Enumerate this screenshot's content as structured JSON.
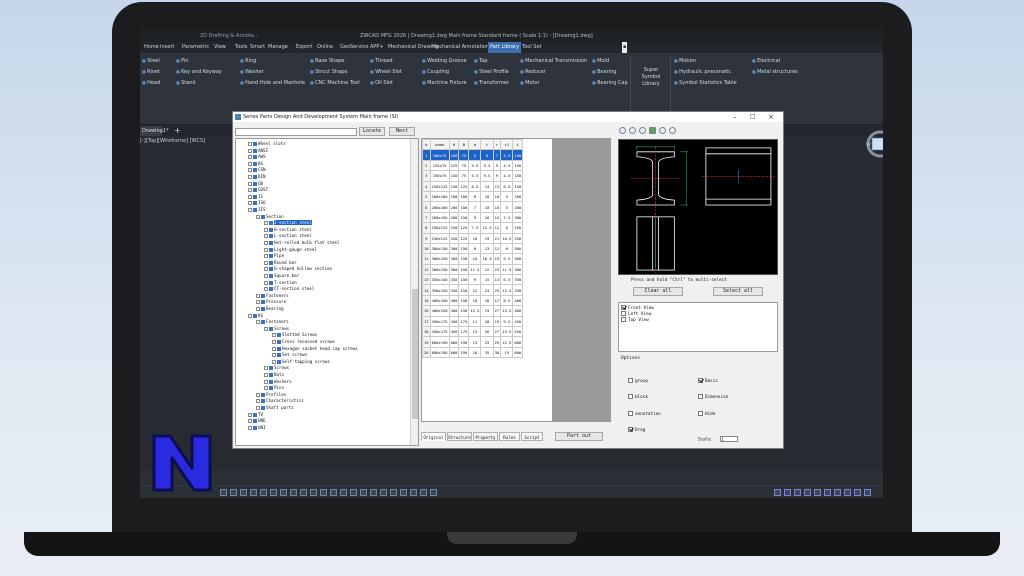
{
  "app": {
    "title": "ZWCAD MFG 2026 | Drawing1.dwg Main frame   Standard frame ( Scale 1:1)  - [Drawing1.dwg]",
    "quick_access": "2D Drafting & Annota..."
  },
  "menu": [
    "Home",
    "Insert",
    "Parametric",
    "View",
    "Tools",
    "Smart",
    "Manage",
    "Export",
    "Online",
    "GeoService",
    "APP+",
    "Mechanical Drawing",
    "Mechanical Annotation",
    "Part Library",
    "Tool Set"
  ],
  "menu_active": "Part Library",
  "ribbon": {
    "col1": [
      "Steel",
      "Rivet",
      "Head"
    ],
    "col2": [
      "Pin",
      "Key and Keyway",
      "Stand"
    ],
    "col3": [
      "Ring",
      "Washer",
      "Hand Hole and Manhole"
    ],
    "col4": [
      "Base Shape",
      "Struct Shape",
      "CNC Machine Tool"
    ],
    "col5": [
      "Thread",
      "Wheel Slot",
      "Oil Slot"
    ],
    "col6": [
      "Welding Groove",
      "Coupling",
      "Machine Fixture"
    ],
    "col7": [
      "Tap",
      "Steel Profile",
      "Transformer"
    ],
    "col8": [
      "Mechanical Transmission",
      "Reducer",
      "Motor"
    ],
    "col9": [
      "Mold",
      "Bearing",
      "Bearing Cap"
    ],
    "super_symbol": "Super Symbol Library",
    "col10": [
      "Motion",
      "Hydraulic pneumatic",
      "Symbol Statistics Table"
    ],
    "col11": [
      "Electrical",
      "Metal structures"
    ],
    "group_part": "Part Library",
    "group_symbol": "Super Symbol Library"
  },
  "doc_tab": "Drawing1*",
  "viewport_label": "[-][Top][Wireframe] [WCS]",
  "dialog": {
    "title": "Series Parts Design And Development System Main frame (SI)",
    "locate_label": "Locate",
    "next_label": "Next",
    "tree": [
      {
        "label": "Wheel slots",
        "level": 0
      },
      {
        "label": "ANSI",
        "level": 0
      },
      {
        "label": "AWS",
        "level": 0
      },
      {
        "label": "BS",
        "level": 0
      },
      {
        "label": "CSN",
        "level": 0
      },
      {
        "label": "DIN",
        "level": 0
      },
      {
        "label": "GB",
        "level": 0
      },
      {
        "label": "GOST",
        "level": 0
      },
      {
        "label": "IS",
        "level": 0
      },
      {
        "label": "ISO",
        "level": 0
      },
      {
        "label": "JIS",
        "level": 0
      },
      {
        "label": "Section",
        "level": 1
      },
      {
        "label": "I-section steel",
        "level": 2,
        "selected": true
      },
      {
        "label": "H-section steel",
        "level": 2
      },
      {
        "label": "L-section steel",
        "level": 2
      },
      {
        "label": "Hot-rolled bulb flat steel",
        "level": 2
      },
      {
        "label": "Light-gauge steel",
        "level": 2
      },
      {
        "label": "Pipe",
        "level": 2
      },
      {
        "label": "Round bar",
        "level": 2
      },
      {
        "label": "U-shaped hollow section",
        "level": 2
      },
      {
        "label": "Square bar",
        "level": 2
      },
      {
        "label": "T-section",
        "level": 2
      },
      {
        "label": "CT-section steel",
        "level": 2
      },
      {
        "label": "Fasteners",
        "level": 1
      },
      {
        "label": "Pressure",
        "level": 1
      },
      {
        "label": "Bearing",
        "level": 1
      },
      {
        "label": "KS",
        "level": 0
      },
      {
        "label": "Fasteners",
        "level": 1
      },
      {
        "label": "Screws",
        "level": 2
      },
      {
        "label": "Slotted Screws",
        "level": 3
      },
      {
        "label": "Cross recessed screws",
        "level": 3
      },
      {
        "label": "Hexagon socket head cap screws",
        "level": 3
      },
      {
        "label": "Set screws",
        "level": 3
      },
      {
        "label": "Self-tapping screws",
        "level": 3
      },
      {
        "label": "Screws",
        "level": 2
      },
      {
        "label": "Nuts",
        "level": 2
      },
      {
        "label": "Washers",
        "level": 2
      },
      {
        "label": "Pins",
        "level": 2
      },
      {
        "label": "Profiles",
        "level": 1
      },
      {
        "label": "Characteristics",
        "level": 1
      },
      {
        "label": "Shaft parts",
        "level": 1
      },
      {
        "label": "TV",
        "level": 0
      },
      {
        "label": "UNE",
        "level": 0
      },
      {
        "label": "UNI",
        "level": 0
      }
    ],
    "table": {
      "columns": [
        "b",
        "name",
        "H",
        "B",
        "d",
        "t",
        "r",
        "r1",
        "L"
      ],
      "rows": [
        [
          "1",
          "100x75",
          "100",
          "75",
          "5",
          "8",
          "7",
          "3.5",
          "150"
        ],
        [
          "2",
          "125x75",
          "125",
          "75",
          "5.5",
          "9.5",
          "9",
          "4.5",
          "150"
        ],
        [
          "3",
          "150x75",
          "150",
          "75",
          "5.5",
          "9.5",
          "9",
          "4.5",
          "150"
        ],
        [
          "4",
          "150x125",
          "150",
          "125",
          "8.5",
          "14",
          "13",
          "6.5",
          "150"
        ],
        [
          "5",
          "180x100",
          "180",
          "100",
          "6",
          "10",
          "10",
          "5",
          "200"
        ],
        [
          "6",
          "200x100",
          "200",
          "100",
          "7",
          "10",
          "10",
          "5",
          "200"
        ],
        [
          "7",
          "200x150",
          "200",
          "150",
          "9",
          "16",
          "15",
          "7.5",
          "300"
        ],
        [
          "8",
          "250x125",
          "250",
          "125",
          "7.5",
          "12.5",
          "12",
          "6",
          "250"
        ],
        [
          "9",
          "250x125",
          "250",
          "125",
          "10",
          "19",
          "21",
          "10.5",
          "250"
        ],
        [
          "10",
          "300x150",
          "300",
          "150",
          "8",
          "13",
          "12",
          "6",
          "300"
        ],
        [
          "11",
          "300x150",
          "300",
          "150",
          "10",
          "18.5",
          "19",
          "9.5",
          "300"
        ],
        [
          "12",
          "300x150",
          "300",
          "150",
          "11.5",
          "22",
          "23",
          "11.5",
          "300"
        ],
        [
          "13",
          "350x150",
          "350",
          "150",
          "9",
          "15",
          "13",
          "6.5",
          "350"
        ],
        [
          "14",
          "350x150",
          "350",
          "150",
          "12",
          "24",
          "25",
          "12.5",
          "350"
        ],
        [
          "15",
          "400x150",
          "400",
          "150",
          "10",
          "18",
          "17",
          "8.5",
          "400"
        ],
        [
          "16",
          "400x150",
          "400",
          "150",
          "12.5",
          "25",
          "27",
          "13.5",
          "400"
        ],
        [
          "17",
          "450x175",
          "450",
          "175",
          "11",
          "20",
          "19",
          "9.5",
          "450"
        ],
        [
          "18",
          "450x175",
          "450",
          "175",
          "13",
          "26",
          "27",
          "13.5",
          "450"
        ],
        [
          "19",
          "600x190",
          "600",
          "190",
          "13",
          "25",
          "25",
          "12.5",
          "600"
        ],
        [
          "20",
          "600x190",
          "600",
          "190",
          "16",
          "35",
          "38",
          "19",
          "600"
        ]
      ],
      "selected_row": 0
    },
    "tabs": [
      "Original",
      "Structure",
      "Property",
      "Rules",
      "Script"
    ],
    "tab_active": "Original",
    "part_out_label": "Part out",
    "hint": "Press and hold \"Ctrl\" to multi-select",
    "clear_all_label": "Clear all",
    "select_all_label": "Select all",
    "views": [
      {
        "label": "Front View",
        "checked": true
      },
      {
        "label": "Left View",
        "checked": false
      },
      {
        "label": "Top View",
        "checked": false
      }
    ],
    "options_title": "Options",
    "options": [
      {
        "label": "group",
        "checked": false
      },
      {
        "label": "Basic",
        "checked": true
      },
      {
        "label": "block",
        "checked": false
      },
      {
        "label": "Dimension",
        "checked": false
      },
      {
        "label": "annotation",
        "checked": false
      },
      {
        "label": "Hide",
        "checked": false
      },
      {
        "label": "Drag",
        "checked": true
      }
    ],
    "scale_label": "Scale",
    "scale_value": "1"
  }
}
